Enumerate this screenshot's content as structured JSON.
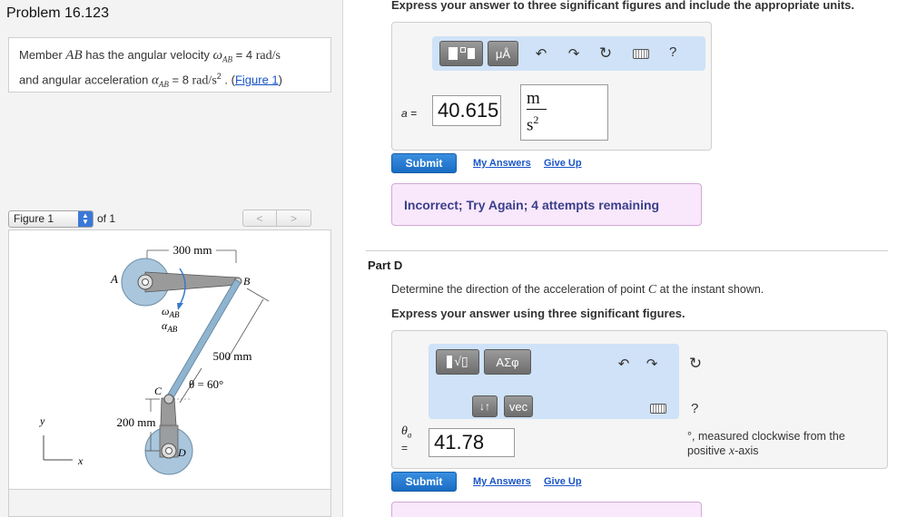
{
  "problem": {
    "title": "Problem 16.123",
    "statement_prefix1": "Member ",
    "member": "AB",
    "statement_mid1": " has the angular velocity ",
    "omega_sym": "ω",
    "sub_ab": "AB",
    "omega_value": " = 4 ",
    "omega_unit": "rad/s",
    "statement_prefix2": "and angular acceleration ",
    "alpha_sym": "α",
    "alpha_value": " = 8 ",
    "alpha_unit": "rad/s",
    "alpha_exp": "2",
    "statement_suffix": " . (",
    "figure_link": "Figure 1",
    "close_paren": ")"
  },
  "figure_nav": {
    "selected": "Figure 1",
    "of_label": "of 1",
    "prev": "<",
    "next": ">"
  },
  "figure": {
    "dim_300": "300 mm",
    "dim_500": "500 mm",
    "dim_200": "200 mm",
    "angle": "θ = 60°",
    "label_A": "A",
    "label_B": "B",
    "label_C": "C",
    "label_D": "D",
    "omega_label": "ω",
    "alpha_label": "α",
    "ab_sub": "AB",
    "axis_x": "x",
    "axis_y": "y",
    "colors": {
      "disk": "#a9c6dc",
      "link": "#8fb4cf",
      "arm": "#9a9a9a"
    }
  },
  "part_c": {
    "instruction": "Express your answer to three significant figures and include the appropriate units.",
    "toolbar": {
      "units_btn": "μÅ",
      "help": "?"
    },
    "var_label": "a =",
    "value": "40.615",
    "unit_num": "m",
    "unit_den": "s",
    "unit_exp": "2",
    "submit": "Submit",
    "my_answers": "My Answers",
    "give_up": "Give Up",
    "feedback": "Incorrect; Try Again; 4 attempts remaining"
  },
  "part_d": {
    "title": "Part D",
    "question_prefix": "Determine the direction of the acceleration of point ",
    "point": "C",
    "question_suffix": " at the instant shown.",
    "instruction": "Express your answer using three significant figures.",
    "toolbar": {
      "greek_btn": "ΑΣφ",
      "sort_btn": "↓↑",
      "vec_btn": "vec",
      "help": "?"
    },
    "var_label": "θ",
    "var_sub": "a",
    "var_eq": "=",
    "value": "41.78",
    "suffix_line1": "°, measured clockwise from the",
    "suffix_line2_prefix": "positive ",
    "suffix_axis": "x",
    "suffix_line2_suffix": "-axis",
    "submit": "Submit",
    "my_answers": "My Answers",
    "give_up": "Give Up"
  }
}
